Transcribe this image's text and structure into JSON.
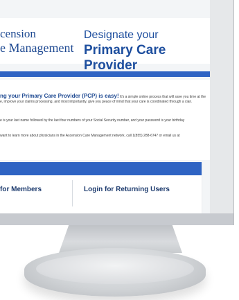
{
  "header": {
    "logo_line1": "cension",
    "logo_line2": "e Management",
    "title_line1": "Designate your",
    "title_line2": "Primary Care Provider"
  },
  "content": {
    "lead": "ng your Primary Care Provider (PCP) is easy!",
    "intro_rest": " It's a simple online process that will save you time at the e, improve your claims processing, and most importantly, give you peace of mind that your care is coordinated through a cian.",
    "p2": "e is your last name followed by the last four numbers of your Social Security number, and your password is your birthday",
    "p3": "want to learn more about physicians in the Ascension Care Management network, call 1(855) 288-6747 or email us at"
  },
  "card": {
    "left_label": "for Members",
    "right_label": "Login for Returning Users"
  },
  "colors": {
    "brand_blue": "#2e63c3",
    "heading_blue": "#1d4e9e"
  }
}
